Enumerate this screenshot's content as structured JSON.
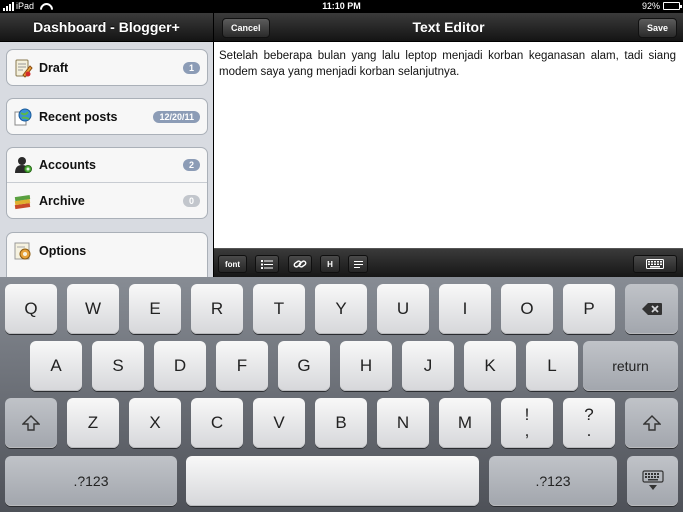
{
  "status": {
    "carrier": "iPad",
    "time": "11:10 PM",
    "battery": "92%",
    "battery_level": 0.92
  },
  "sidebar": {
    "title": "Dashboard - Blogger+",
    "draft": {
      "label": "Draft",
      "badge": "1",
      "icon": "draft-icon"
    },
    "recent": {
      "label": "Recent posts",
      "badge": "12/20/11",
      "icon": "globe-icon"
    },
    "accounts": {
      "label": "Accounts",
      "badge": "2",
      "icon": "user-icon"
    },
    "archive": {
      "label": "Archive",
      "badge": "0",
      "icon": "books-icon"
    },
    "options": {
      "label": "Options",
      "icon": "options-icon"
    }
  },
  "editor": {
    "title": "Text Editor",
    "cancel_label": "Cancel",
    "save_label": "Save",
    "body": "Setelah beberapa bulan yang lalu leptop menjadi korban keganasan alam, tadi siang modem saya yang menjadi korban selanjutnya."
  },
  "toolbar": {
    "font_label": "font",
    "heading_label": "H"
  },
  "keyboard": {
    "row1": [
      "Q",
      "W",
      "E",
      "R",
      "T",
      "Y",
      "U",
      "I",
      "O",
      "P"
    ],
    "row2": [
      "A",
      "S",
      "D",
      "F",
      "G",
      "H",
      "J",
      "K",
      "L"
    ],
    "row3": [
      "Z",
      "X",
      "C",
      "V",
      "B",
      "N",
      "M"
    ],
    "return_label": "return",
    "excl": [
      "!",
      ","
    ],
    "ques": [
      "?",
      "."
    ],
    "numbers_label": ".?123"
  }
}
